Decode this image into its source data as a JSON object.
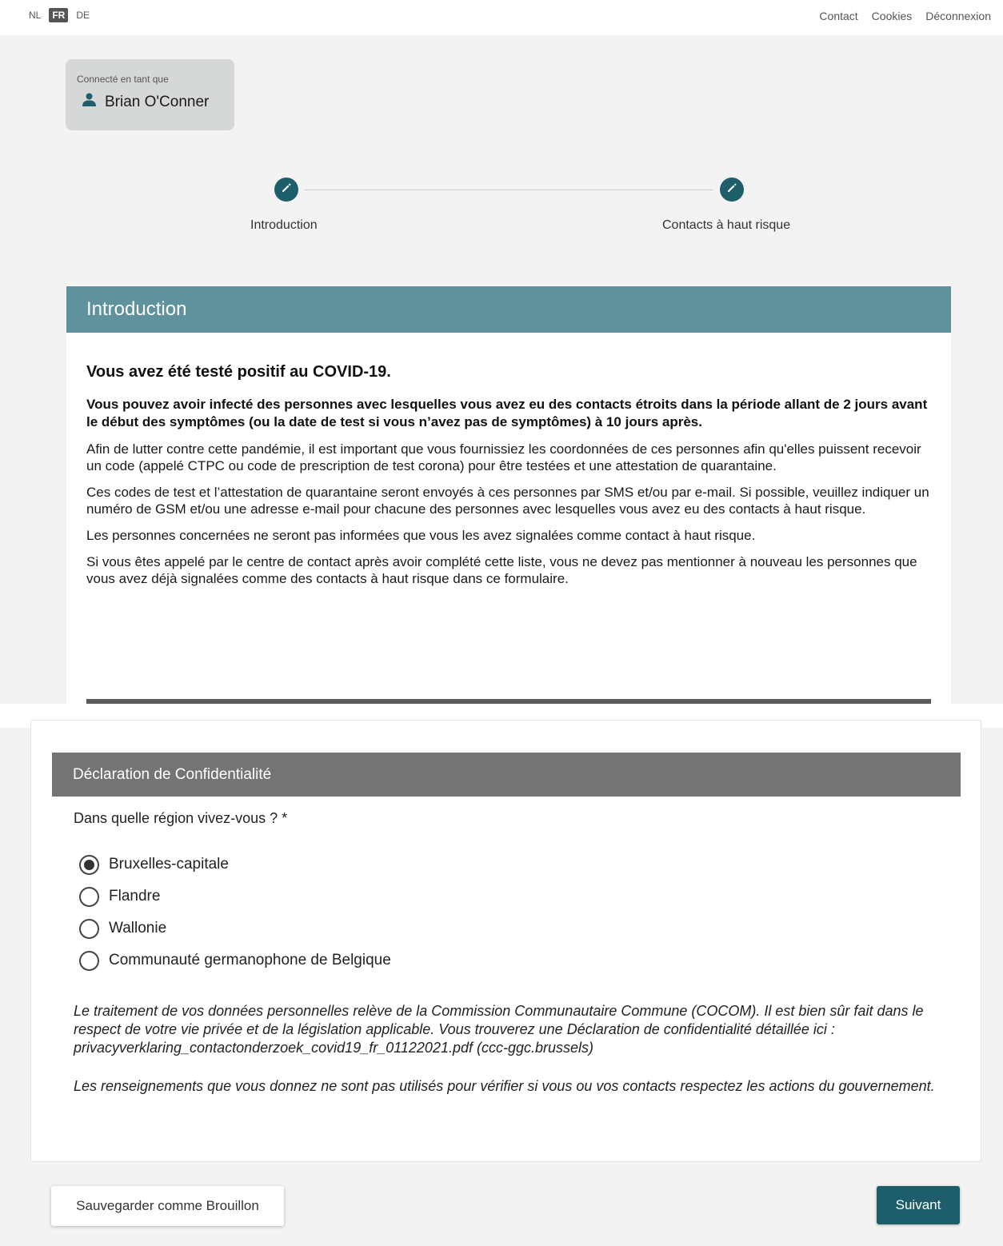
{
  "header": {
    "languages": [
      "NL",
      "FR",
      "DE"
    ],
    "active_language": "FR",
    "links": [
      "Contact",
      "Cookies",
      "Déconnexion"
    ]
  },
  "user": {
    "label": "Connecté en tant que",
    "name": "Brian O'Conner"
  },
  "steps": [
    {
      "label": "Introduction"
    },
    {
      "label": "Contacts à haut risque"
    }
  ],
  "intro": {
    "title": "Introduction",
    "heading": "Vous avez été testé positif au COVID-19.",
    "bold_text": "Vous pouvez avoir infecté des personnes avec lesquelles vous avez eu des contacts étroits dans la période allant de 2 jours avant le début des symptômes (ou la date de test si vous n’avez pas de symptômes) à 10 jours après.",
    "paragraphs": [
      "Afin de lutter contre cette pandémie, il est important que vous fournissiez les coordonnées de ces personnes afin qu'elles puissent recevoir un code (appelé CTPC ou code de prescription de test corona) pour être testées et une attestation de quarantaine.",
      "Ces codes de test et l’attestation de quarantaine seront envoyés à ces personnes par SMS et/ou par e-mail. Si possible, veuillez indiquer un numéro de GSM et/ou une adresse e-mail pour chacune des personnes avec lesquelles vous avez eu des contacts à haut risque.",
      "Les personnes concernées ne seront pas informées que vous les avez signalées comme contact à haut risque.",
      "Si vous êtes appelé par le centre de contact après avoir complété cette liste, vous ne devez pas mentionner à nouveau les personnes que vous avez déjà signalées comme des contacts à haut risque dans ce formulaire."
    ]
  },
  "privacy": {
    "title": "Déclaration de Confidentialité",
    "question": "Dans quelle région vivez-vous ? *",
    "options": [
      "Bruxelles-capitale",
      "Flandre",
      "Wallonie",
      "Communauté germanophone de Belgique"
    ],
    "selected": "Bruxelles-capitale",
    "note1": "Le traitement de vos données personnelles relève de la Commission Communautaire Commune (COCOM). Il est bien sûr fait dans le respect de votre vie privée et de la législation applicable. Vous trouverez une Déclaration de confidentialité détaillée ici : privacyverklaring_contactonderzoek_covid19_fr_01122021.pdf (ccc-ggc.brussels)",
    "note2": "Les renseignements que vous donnez ne sont pas utilisés pour vérifier si vous ou vos contacts respectez les actions du gouvernement."
  },
  "buttons": {
    "draft": "Sauvegarder comme Brouillon",
    "next": "Suivant"
  },
  "colors": {
    "accent": "#1e5e6b",
    "section_header": "#5f929c",
    "privacy_header": "#747474"
  },
  "icons": {
    "step": "pencil-icon",
    "user": "person-icon"
  }
}
